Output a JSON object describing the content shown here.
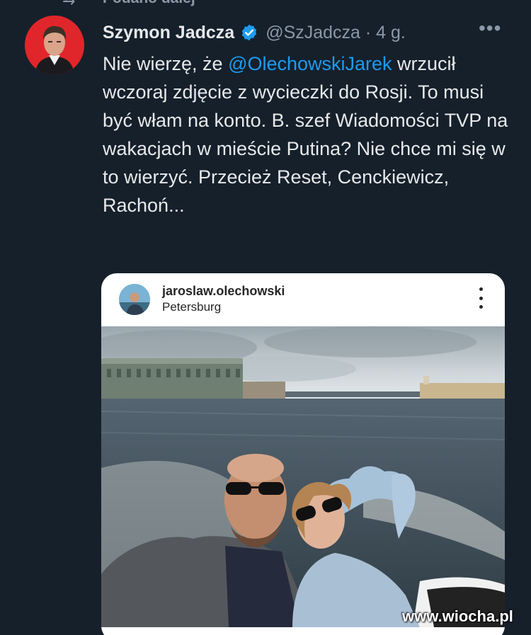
{
  "repost": {
    "label": "Podano dalej",
    "icon": "repost-icon"
  },
  "tweet": {
    "author_name": "Szymon Jadcza",
    "handle_time": "@SzJadcza · 4 g.",
    "more_label": "•••",
    "text_part1": "Nie wierzę, że ",
    "mention": "@OlechowskiJarek",
    "text_part2": " wrzucił wczoraj zdjęcie z wycieczki do Rosji. To musi być włam na konto. B. szef Wiadomości TVP na wakacjach w mieście Putina? Nie chce mi się w to wierzyć. Przecież Reset, Cenckiewicz, Rachoń..."
  },
  "instagram": {
    "username": "jaroslaw.olechowski",
    "location": "Petersburg"
  },
  "watermark": "www.wiocha.pl",
  "colors": {
    "background": "#15202b",
    "text": "#e7e9ea",
    "muted": "#8b98a5",
    "link": "#1d9bf0",
    "avatar_bg": "#e0262b"
  }
}
